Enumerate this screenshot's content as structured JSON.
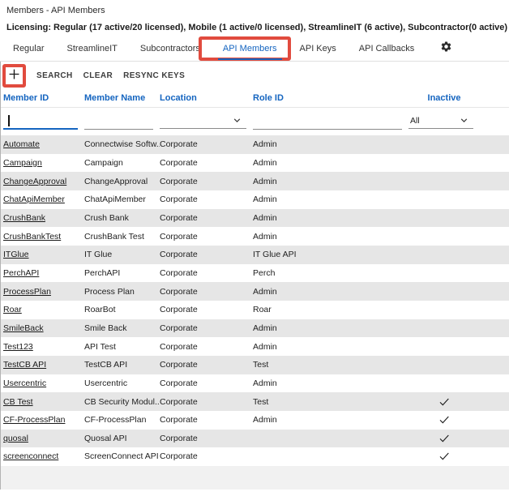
{
  "page": {
    "breadcrumb": "Members - API Members",
    "licensing": "Licensing: Regular (17 active/20 licensed), Mobile (1 active/0 licensed), StreamlineIT (6 active), Subcontractor(0 active)"
  },
  "tabs": {
    "items": [
      {
        "label": "Regular",
        "selected": false
      },
      {
        "label": "StreamlineIT",
        "selected": false
      },
      {
        "label": "Subcontractors",
        "selected": false
      },
      {
        "label": "API Members",
        "selected": true,
        "annotated": true
      },
      {
        "label": "API Keys",
        "selected": false
      },
      {
        "label": "API Callbacks",
        "selected": false
      }
    ]
  },
  "toolbar": {
    "search_label": "SEARCH",
    "clear_label": "CLEAR",
    "resync_label": "RESYNC KEYS"
  },
  "table": {
    "columns": {
      "member_id": "Member ID",
      "member_name": "Member Name",
      "location": "Location",
      "role_id": "Role ID",
      "inactive": "Inactive"
    },
    "filters": {
      "member_id_value": "",
      "member_name_value": "",
      "location_value": "",
      "role_id_value": "",
      "inactive_selected": "All"
    },
    "rows": [
      {
        "member_id": "Automate",
        "member_name": "Connectwise Softw...",
        "location": "Corporate",
        "role_id": "Admin",
        "inactive": false
      },
      {
        "member_id": "Campaign",
        "member_name": "Campaign",
        "location": "Corporate",
        "role_id": "Admin",
        "inactive": false
      },
      {
        "member_id": "ChangeApproval",
        "member_name": "ChangeApproval",
        "location": "Corporate",
        "role_id": "Admin",
        "inactive": false
      },
      {
        "member_id": "ChatApiMember",
        "member_name": "ChatApiMember",
        "location": "Corporate",
        "role_id": "Admin",
        "inactive": false
      },
      {
        "member_id": "CrushBank",
        "member_name": "Crush Bank",
        "location": "Corporate",
        "role_id": "Admin",
        "inactive": false
      },
      {
        "member_id": "CrushBankTest",
        "member_name": "CrushBank Test",
        "location": "Corporate",
        "role_id": "Admin",
        "inactive": false
      },
      {
        "member_id": "ITGlue",
        "member_name": "IT Glue",
        "location": "Corporate",
        "role_id": "IT Glue API",
        "inactive": false
      },
      {
        "member_id": "PerchAPI",
        "member_name": "PerchAPI",
        "location": "Corporate",
        "role_id": "Perch",
        "inactive": false
      },
      {
        "member_id": "ProcessPlan",
        "member_name": "Process Plan",
        "location": "Corporate",
        "role_id": "Admin",
        "inactive": false
      },
      {
        "member_id": "Roar",
        "member_name": "RoarBot",
        "location": "Corporate",
        "role_id": "Roar",
        "inactive": false
      },
      {
        "member_id": "SmileBack",
        "member_name": "Smile Back",
        "location": "Corporate",
        "role_id": "Admin",
        "inactive": false
      },
      {
        "member_id": "Test123",
        "member_name": "API Test",
        "location": "Corporate",
        "role_id": "Admin",
        "inactive": false
      },
      {
        "member_id": "TestCB API",
        "member_name": "TestCB API",
        "location": "Corporate",
        "role_id": "Test",
        "inactive": false
      },
      {
        "member_id": "Usercentric",
        "member_name": "Usercentric",
        "location": "Corporate",
        "role_id": "Admin",
        "inactive": false
      },
      {
        "member_id": "CB Test",
        "member_name": "CB Security Modul...",
        "location": "Corporate",
        "role_id": "Test",
        "inactive": true
      },
      {
        "member_id": "CF-ProcessPlan",
        "member_name": "CF-ProcessPlan",
        "location": "Corporate",
        "role_id": "Admin",
        "inactive": true
      },
      {
        "member_id": "quosal",
        "member_name": "Quosal API",
        "location": "Corporate",
        "role_id": "",
        "inactive": true
      },
      {
        "member_id": "screenconnect",
        "member_name": "ScreenConnect API",
        "location": "Corporate",
        "role_id": "",
        "inactive": true
      }
    ]
  },
  "icons": {
    "settings": "gear-icon",
    "add": "plus-icon",
    "dropdown": "chevron-down-icon",
    "inactive_mark": "check-icon"
  },
  "annotations": {
    "highlight_color": "#e14b3e",
    "highlighted_elements": [
      "tab-api-members",
      "add-member-button"
    ]
  },
  "colors": {
    "accent": "#1565c0",
    "annotation_red": "#e14b3e",
    "row_stripe": "#e6e6e6",
    "footer_gray": "#f1f1f1"
  }
}
